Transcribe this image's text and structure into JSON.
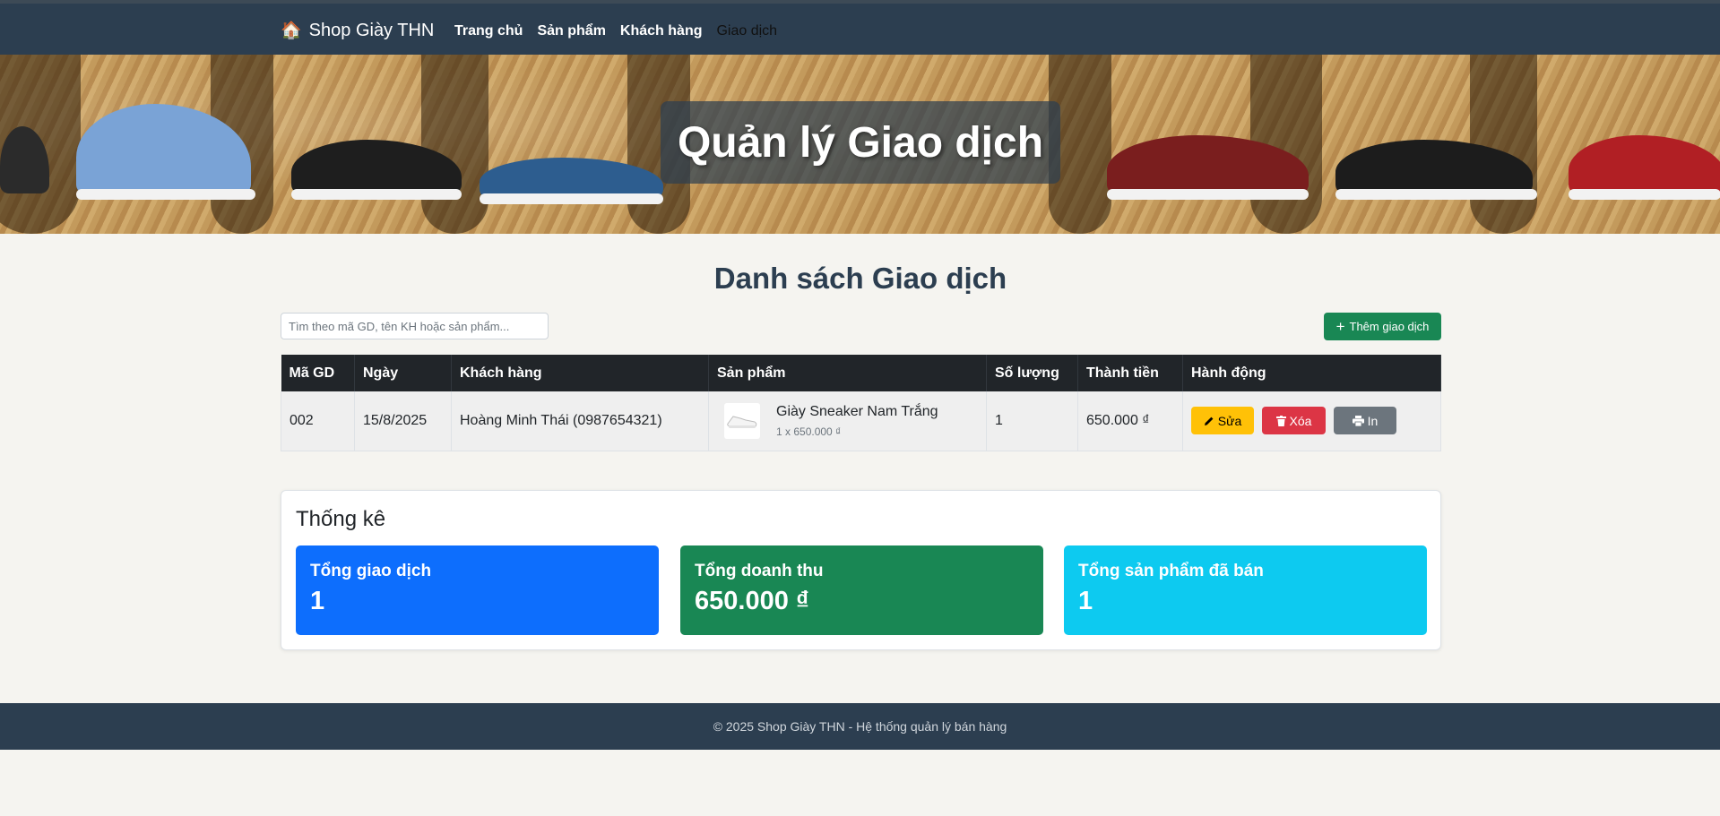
{
  "navbar": {
    "brand_icon": "🏠",
    "brand": "Shop Giày THN",
    "links": [
      {
        "label": "Trang chủ"
      },
      {
        "label": "Sản phẩm"
      },
      {
        "label": "Khách hàng"
      },
      {
        "label": "Giao dịch",
        "active": true
      }
    ]
  },
  "hero": {
    "title": "Quản lý Giao dịch"
  },
  "page": {
    "section_title": "Danh sách Giao dịch",
    "search_placeholder": "Tìm theo mã GD, tên KH hoặc sản phẩm...",
    "add_button": "Thêm giao dịch"
  },
  "table": {
    "headers": [
      "Mã GD",
      "Ngày",
      "Khách hàng",
      "Sản phẩm",
      "Số lượng",
      "Thành tiền",
      "Hành động"
    ],
    "rows": [
      {
        "id": "002",
        "date": "15/8/2025",
        "customer": "Hoàng Minh Thái (0987654321)",
        "product_name": "Giày Sneaker Nam Trắng",
        "product_detail": "1 x 650.000 ₫",
        "quantity": "1",
        "total": "650.000 ₫",
        "actions": {
          "edit": "Sửa",
          "delete": "Xóa",
          "print": "In"
        }
      }
    ]
  },
  "stats": {
    "title": "Thống kê",
    "cards": [
      {
        "label": "Tổng giao dịch",
        "value": "1",
        "color": "#0d6efd"
      },
      {
        "label": "Tổng doanh thu",
        "value": "650.000 ₫",
        "color": "#198754"
      },
      {
        "label": "Tổng sản phẩm đã bán",
        "value": "1",
        "color": "#0dcaf0"
      }
    ]
  },
  "footer": {
    "text": "© 2025 Shop Giày THN - Hệ thống quản lý bán hàng"
  },
  "colors": {
    "navbar": "#2c3e50",
    "title": "#2c3e50",
    "table_header": "#212529",
    "edit": "#ffc107",
    "delete": "#dc3545",
    "print": "#6c757d"
  },
  "icons": {
    "brand": "home-icon",
    "add": "plus-icon",
    "edit": "pencil-icon",
    "delete": "trash-icon",
    "print": "printer-icon"
  }
}
